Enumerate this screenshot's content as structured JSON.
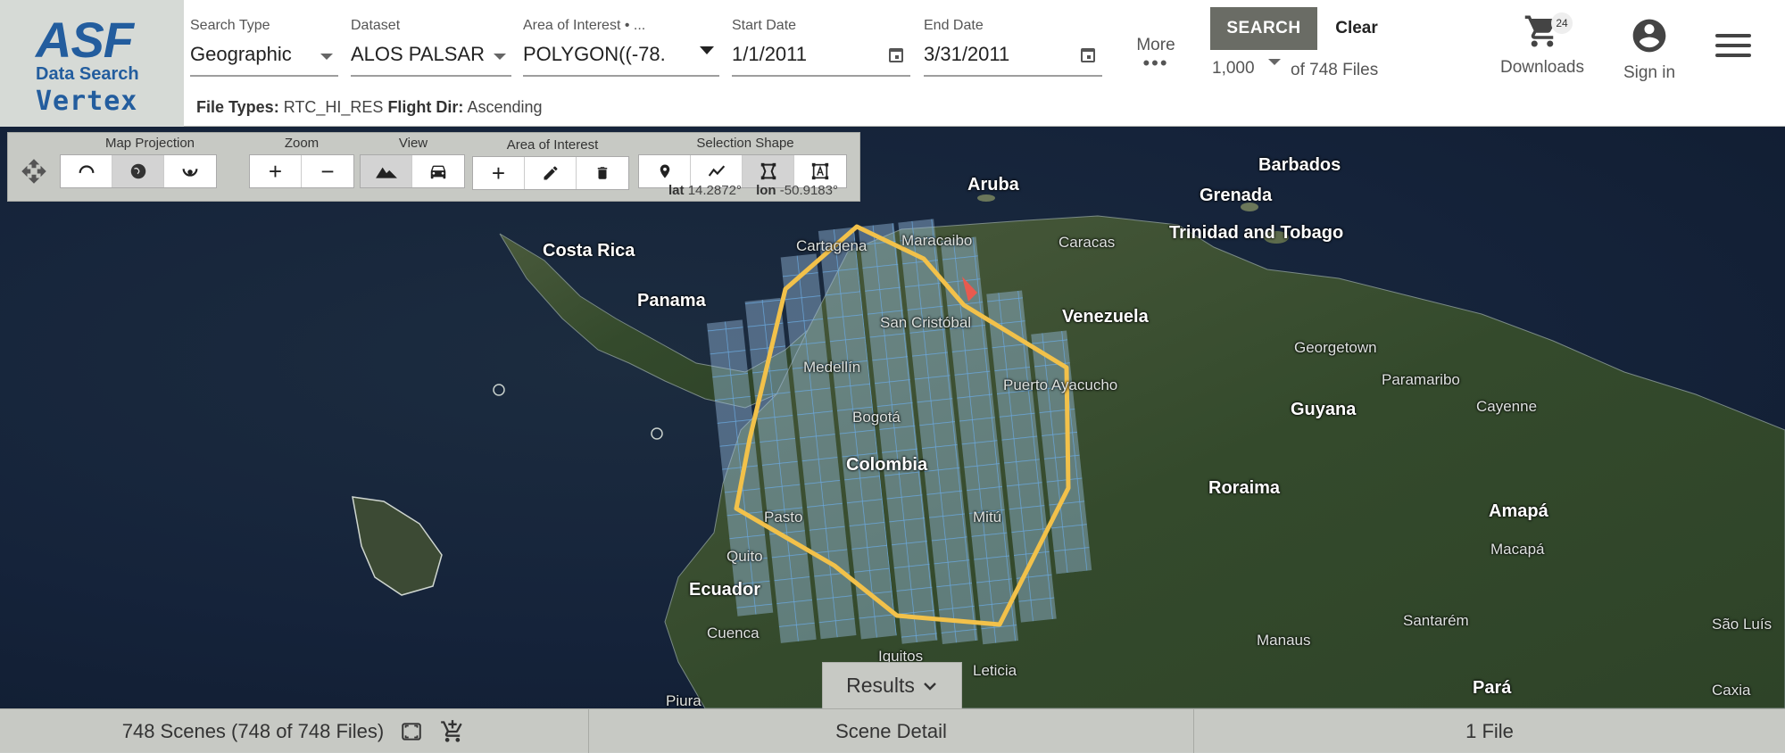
{
  "logo": {
    "asf": "ASF",
    "line1": "Data Search",
    "line2": "Vertex"
  },
  "search_type": {
    "label": "Search Type",
    "value": "Geographic"
  },
  "dataset": {
    "label": "Dataset",
    "value": "ALOS PALSAR"
  },
  "aoi": {
    "label": "Area of Interest • ...",
    "value": "POLYGON((-78."
  },
  "start_date": {
    "label": "Start Date",
    "value": "1/1/2011"
  },
  "end_date": {
    "label": "End Date",
    "value": "3/31/2011"
  },
  "more": {
    "label": "More",
    "dots": "•••"
  },
  "actions": {
    "search": "SEARCH",
    "clear": "Clear",
    "max_results": "1,000",
    "of_files": "of 748 Files"
  },
  "downloads": {
    "label": "Downloads",
    "count": "24"
  },
  "signin": {
    "label": "Sign in"
  },
  "filters": {
    "file_types_label": "File Types:",
    "file_types_value": "RTC_HI_RES",
    "flight_dir_label": "Flight Dir:",
    "flight_dir_value": "Ascending"
  },
  "map_toolbar": {
    "projection_label": "Map Projection",
    "zoom_label": "Zoom",
    "view_label": "View",
    "aoi_label": "Area of Interest",
    "shape_label": "Selection Shape",
    "lat_label": "lat",
    "lat_value": "14.2872°",
    "lon_label": "lon",
    "lon_value": "-50.9183°"
  },
  "places": {
    "aruba": "Aruba",
    "barbados": "Barbados",
    "grenada": "Grenada",
    "trinidad": "Trinidad and Tobago",
    "costa_rica": "Costa Rica",
    "cartagena": "Cartagena",
    "maracaibo": "Maracaibo",
    "caracas": "Caracas",
    "panama": "Panama",
    "venezuela": "Venezuela",
    "georgetown": "Georgetown",
    "paramaribo": "Paramaribo",
    "cayenne": "Cayenne",
    "guyana": "Guyana",
    "san_cristobal": "San Cristóbal",
    "medellin": "Medellín",
    "puerto_ayacucho": "Puerto Ayacucho",
    "bogota": "Bogotá",
    "colombia": "Colombia",
    "roraima": "Roraima",
    "amapa": "Amapá",
    "macapa": "Macapá",
    "pasto": "Pasto",
    "mitu": "Mitú",
    "quito": "Quito",
    "ecuador": "Ecuador",
    "cuenca": "Cuenca",
    "santarem": "Santarém",
    "manaus": "Manaus",
    "sao_luis": "São Luís",
    "iquitos": "Iquitos",
    "leticia": "Leticia",
    "piura": "Piura",
    "para": "Pará",
    "caxias": "Caxia"
  },
  "results_tab": {
    "label": "Results"
  },
  "bottom": {
    "scenes": "748 Scenes (748 of 748 Files)",
    "scene_detail": "Scene Detail",
    "files": "1 File"
  }
}
